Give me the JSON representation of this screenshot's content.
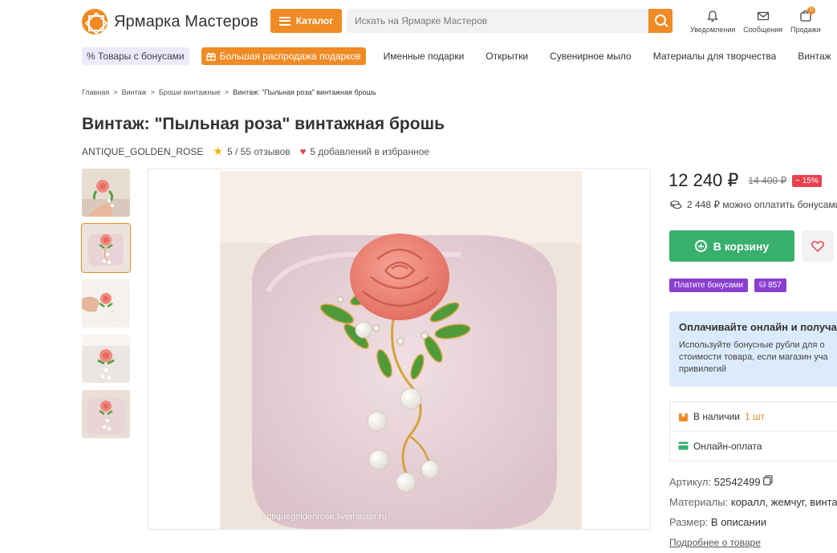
{
  "header": {
    "logo_text": "Ярмарка Мастеров",
    "catalog_label": "Каталог",
    "search_placeholder": "Искать на Ярмарке Мастеров",
    "icons": [
      {
        "name": "bell-icon",
        "label": "Уведомления"
      },
      {
        "name": "envelope-icon",
        "label": "Сообщения"
      },
      {
        "name": "cart-icon",
        "label": "Продажи",
        "badge": "0"
      }
    ]
  },
  "nav": {
    "bonus_chip": "% Товары с бонусами",
    "sale_chip": "Большая распродажа подарков",
    "links": [
      "Именные подарки",
      "Открытки",
      "Сувенирное мыло",
      "Материалы для творчества",
      "Винтаж"
    ]
  },
  "breadcrumbs": [
    "Главная",
    "Винтаж",
    "Броши винтажные",
    "Винтаж: \"Пыльная роза\" винтажная брошь"
  ],
  "product": {
    "title": "Винтаж: \"Пыльная роза\" винтажная брошь",
    "shop": "ANTIQUE_GOLDEN_ROSE",
    "rating": "5",
    "reviews": "/ 55 отзывов",
    "favorites": "5 добавлений в избранное",
    "watermark": "antiquegoldenrose.livemaster.ru",
    "price": "12 240 ₽",
    "old_price": "14 400 ₽",
    "discount": "− 15%",
    "bonus_pay": "2 448 ₽ можно оплатить бонусами",
    "cart_label": "В корзину",
    "pay_bonus_label": "Платите бонусами",
    "bonus_count": "857",
    "info_title": "Оплачивайте онлайн и получа",
    "info_text": [
      "Используйте бонусные рубли для о",
      "стоимости товара, если магазин уча",
      "привилегий"
    ],
    "stock_label": "В наличии",
    "stock_qty": "1 шт",
    "online_pay": "Онлайн-оплата",
    "article_label": "Артикул:",
    "article_value": "52542499",
    "materials_label": "Материалы:",
    "materials_value": "коралл, жемчуг, винта",
    "size_label": "Размер:",
    "size_value": "В описании",
    "more_link": "Подробнее о товаре"
  },
  "colors": {
    "brand_orange": "#f08a24",
    "cart_green": "#37b06b",
    "bonus_purple": "#8a3fd1",
    "discount_red": "#e8404c"
  }
}
